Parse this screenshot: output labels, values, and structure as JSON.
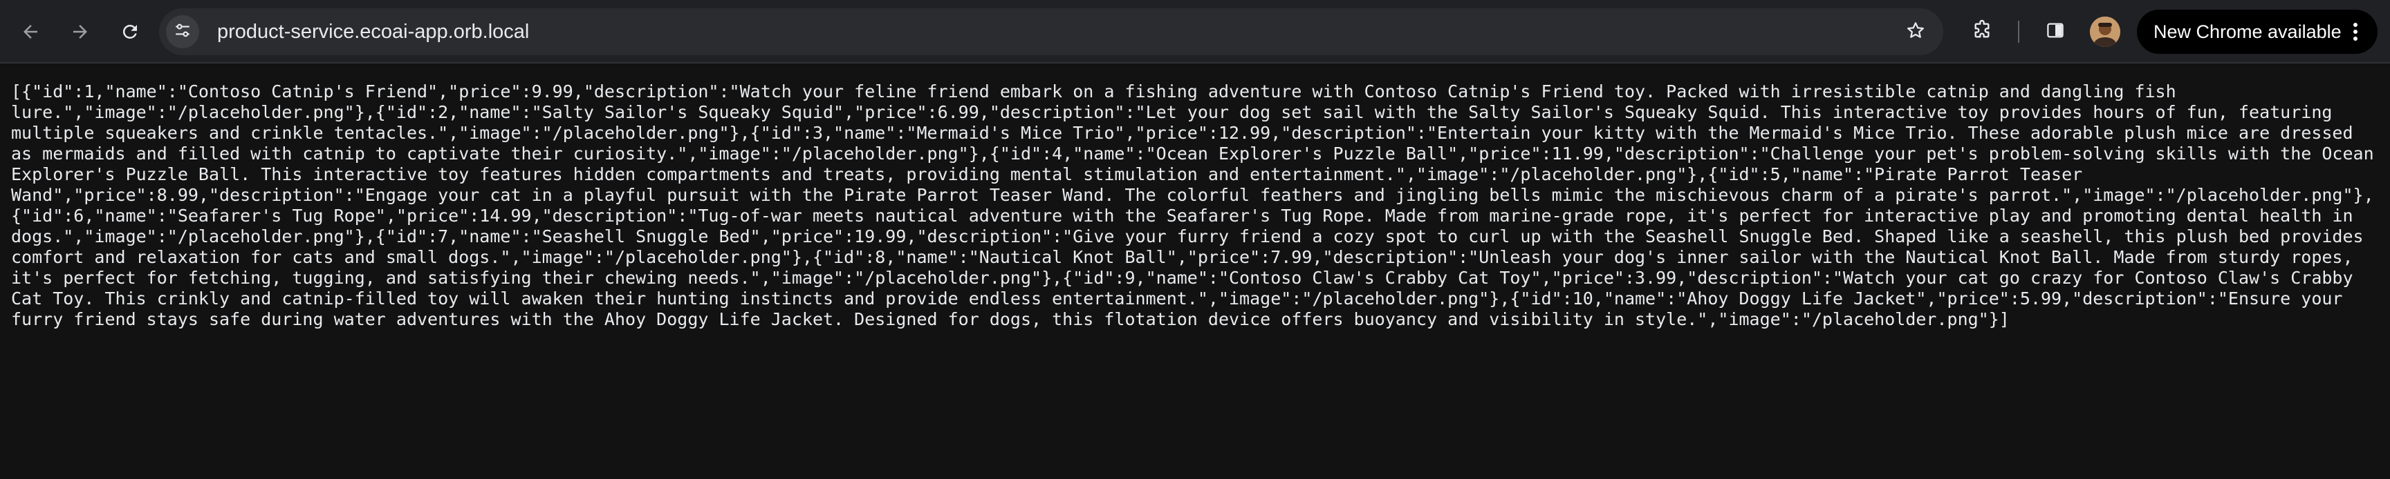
{
  "browser": {
    "url": "product-service.ecoai-app.orb.local",
    "update_label": "New Chrome available",
    "icons": {
      "back": "arrow-left-icon",
      "forward": "arrow-right-icon",
      "reload": "reload-icon",
      "site_info": "tune-icon",
      "bookmark": "star-icon",
      "extensions": "puzzle-icon",
      "side_panel": "side-panel-icon",
      "menu": "kebab-menu-icon"
    }
  },
  "page": {
    "raw_text": "[{\"id\":1,\"name\":\"Contoso Catnip's Friend\",\"price\":9.99,\"description\":\"Watch your feline friend embark on a fishing adventure with Contoso Catnip's Friend toy. Packed with irresistible catnip and dangling fish lure.\",\"image\":\"/placeholder.png\"},{\"id\":2,\"name\":\"Salty Sailor's Squeaky Squid\",\"price\":6.99,\"description\":\"Let your dog set sail with the Salty Sailor's Squeaky Squid. This interactive toy provides hours of fun, featuring multiple squeakers and crinkle tentacles.\",\"image\":\"/placeholder.png\"},{\"id\":3,\"name\":\"Mermaid's Mice Trio\",\"price\":12.99,\"description\":\"Entertain your kitty with the Mermaid's Mice Trio. These adorable plush mice are dressed as mermaids and filled with catnip to captivate their curiosity.\",\"image\":\"/placeholder.png\"},{\"id\":4,\"name\":\"Ocean Explorer's Puzzle Ball\",\"price\":11.99,\"description\":\"Challenge your pet's problem-solving skills with the Ocean Explorer's Puzzle Ball. This interactive toy features hidden compartments and treats, providing mental stimulation and entertainment.\",\"image\":\"/placeholder.png\"},{\"id\":5,\"name\":\"Pirate Parrot Teaser Wand\",\"price\":8.99,\"description\":\"Engage your cat in a playful pursuit with the Pirate Parrot Teaser Wand. The colorful feathers and jingling bells mimic the mischievous charm of a pirate's parrot.\",\"image\":\"/placeholder.png\"},{\"id\":6,\"name\":\"Seafarer's Tug Rope\",\"price\":14.99,\"description\":\"Tug-of-war meets nautical adventure with the Seafarer's Tug Rope. Made from marine-grade rope, it's perfect for interactive play and promoting dental health in dogs.\",\"image\":\"/placeholder.png\"},{\"id\":7,\"name\":\"Seashell Snuggle Bed\",\"price\":19.99,\"description\":\"Give your furry friend a cozy spot to curl up with the Seashell Snuggle Bed. Shaped like a seashell, this plush bed provides comfort and relaxation for cats and small dogs.\",\"image\":\"/placeholder.png\"},{\"id\":8,\"name\":\"Nautical Knot Ball\",\"price\":7.99,\"description\":\"Unleash your dog's inner sailor with the Nautical Knot Ball. Made from sturdy ropes, it's perfect for fetching, tugging, and satisfying their chewing needs.\",\"image\":\"/placeholder.png\"},{\"id\":9,\"name\":\"Contoso Claw's Crabby Cat Toy\",\"price\":3.99,\"description\":\"Watch your cat go crazy for Contoso Claw's Crabby Cat Toy. This crinkly and catnip-filled toy will awaken their hunting instincts and provide endless entertainment.\",\"image\":\"/placeholder.png\"},{\"id\":10,\"name\":\"Ahoy Doggy Life Jacket\",\"price\":5.99,\"description\":\"Ensure your furry friend stays safe during water adventures with the Ahoy Doggy Life Jacket. Designed for dogs, this flotation device offers buoyancy and visibility in style.\",\"image\":\"/placeholder.png\"}]"
  },
  "colors": {
    "toolbar_bg": "#202124",
    "omnibox_bg": "#2b2c2f",
    "page_bg": "#121212",
    "text": "#e8eaed",
    "update_pill_bg": "#000000"
  }
}
